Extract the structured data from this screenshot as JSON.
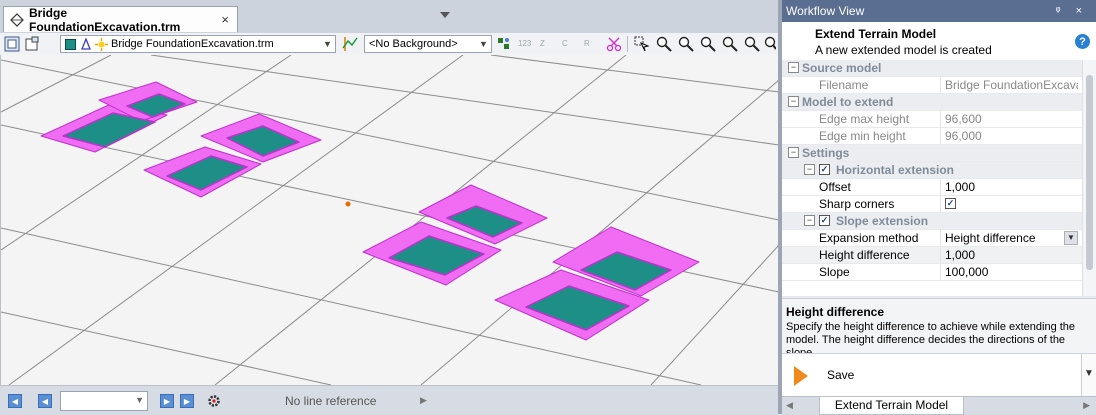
{
  "document": {
    "tab_title": "Bridge FoundationExcavation.trm",
    "tab_close": "×"
  },
  "toolbar": {
    "model_combo": "Bridge FoundationExcavation.trm",
    "background_combo": "<No Background>",
    "tiny_labels": [
      "123",
      "Z",
      "C",
      "R"
    ]
  },
  "statusbar": {
    "line_reference": "No line reference"
  },
  "workflow": {
    "header": "Workflow View",
    "header_icons": "ᵠ ×",
    "title": "Extend Terrain Model",
    "subtitle": "A new extended model is created",
    "help": "?",
    "properties": {
      "source_model": {
        "label": "Source model",
        "filename_label": "Filename",
        "filename_value": "Bridge FoundationExcava..."
      },
      "model_to_extend": {
        "label": "Model to extend",
        "edge_max_label": "Edge max height",
        "edge_max_value": "96,600",
        "edge_min_label": "Edge min height",
        "edge_min_value": "96,000"
      },
      "settings": {
        "label": "Settings",
        "horizontal_extension": "Horizontal extension",
        "horizontal_checked": true,
        "offset_label": "Offset",
        "offset_value": "1,000",
        "sharp_corners_label": "Sharp corners",
        "sharp_corners_checked": true,
        "slope_extension": "Slope extension",
        "slope_checked": true,
        "expansion_method_label": "Expansion method",
        "expansion_method_value": "Height difference",
        "height_difference_label": "Height difference",
        "height_difference_value": "1,000",
        "slope_label": "Slope",
        "slope_value": "100,000"
      }
    },
    "description": {
      "title": "Height difference",
      "text": "Specify the height difference to achieve while extending the model. The height difference decides the directions of the slope."
    },
    "save_label": "Save",
    "bottom_tab": "Extend Terrain Model"
  },
  "colors": {
    "excavation_outer": "#f06cf2",
    "excavation_edge": "#c12fd1",
    "excavation_floor": "#1e8f86",
    "accent_header": "#596e90",
    "save_chevron": "#f08a1c"
  },
  "icons": {
    "tab": "terrain-model-icon",
    "save": "chevron-right-icon",
    "help": "help-icon"
  }
}
